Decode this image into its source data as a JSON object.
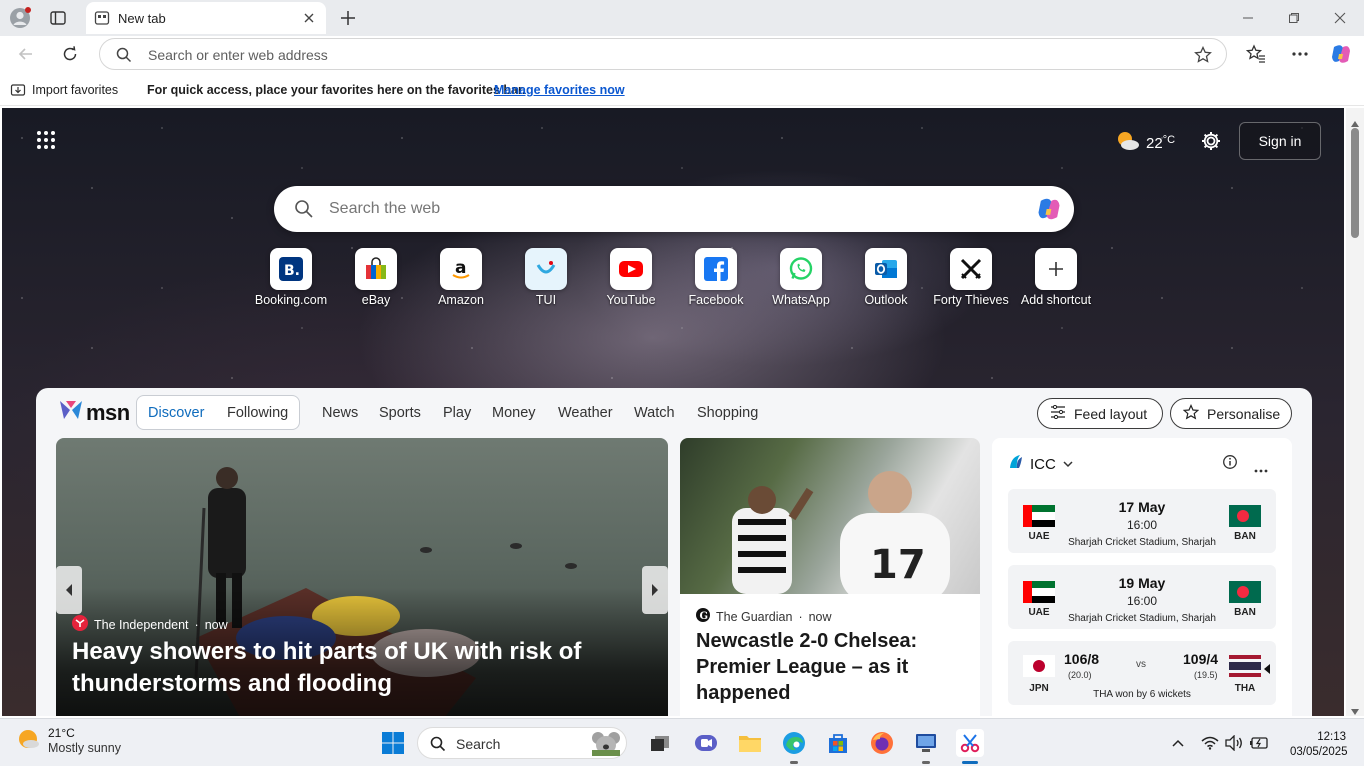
{
  "browser": {
    "tab_title": "New tab",
    "address_placeholder": "Search or enter web address",
    "favorites_bar": {
      "import_label": "Import favorites",
      "message": "For quick access, place your favorites here on the favorites bar.",
      "manage_link": "Manage favorites now"
    }
  },
  "newtab": {
    "weather": {
      "temp": "22",
      "unit": "°C"
    },
    "signin_label": "Sign in",
    "search_placeholder": "Search the web",
    "shortcuts": [
      {
        "label": "Booking.com",
        "icon": "booking-icon"
      },
      {
        "label": "eBay",
        "icon": "ebay-icon"
      },
      {
        "label": "Amazon",
        "icon": "amazon-icon"
      },
      {
        "label": "TUI",
        "icon": "tui-icon"
      },
      {
        "label": "YouTube",
        "icon": "youtube-icon"
      },
      {
        "label": "Facebook",
        "icon": "facebook-icon"
      },
      {
        "label": "WhatsApp",
        "icon": "whatsapp-icon"
      },
      {
        "label": "Outlook",
        "icon": "outlook-icon"
      },
      {
        "label": "Forty Thieves",
        "icon": "forty-thieves-icon"
      },
      {
        "label": "Add shortcut",
        "icon": "plus-icon"
      }
    ]
  },
  "feed": {
    "brand": "msn",
    "tabs": [
      "Discover",
      "Following"
    ],
    "nav": [
      "News",
      "Sports",
      "Play",
      "Money",
      "Weather",
      "Watch",
      "Shopping"
    ],
    "feed_layout_label": "Feed layout",
    "personalise_label": "Personalise",
    "hero": {
      "source": "The Independent",
      "time": "now",
      "title": "Heavy showers to hit parts of UK with risk of thunderstorms and flooding"
    },
    "card2": {
      "source": "The Guardian",
      "time": "now",
      "title": "Newcastle 2-0 Chelsea: Premier League – as it happened"
    },
    "icc": {
      "title": "ICC",
      "matches": [
        {
          "date": "17 May",
          "time": "16:00",
          "venue": "Sharjah Cricket Stadium, Sharjah",
          "team1": "UAE",
          "team2": "BAN"
        },
        {
          "date": "19 May",
          "time": "16:00",
          "venue": "Sharjah Cricket Stadium, Sharjah",
          "team1": "UAE",
          "team2": "BAN"
        }
      ],
      "result": {
        "team1": "JPN",
        "score1": "106/8",
        "overs1": "(20.0)",
        "vs": "vs",
        "team2": "THA",
        "score2": "109/4",
        "overs2": "(19.5)",
        "summary": "THA won by 6 wickets"
      }
    }
  },
  "taskbar": {
    "weather_temp": "21°C",
    "weather_desc": "Mostly sunny",
    "search_label": "Search",
    "time": "12:13",
    "date": "03/05/2025"
  },
  "colors": {
    "accent": "#0f6cbd",
    "link": "#0b57d0",
    "youtube": "#ff0000",
    "facebook": "#1877f2",
    "whatsapp": "#25d366"
  }
}
